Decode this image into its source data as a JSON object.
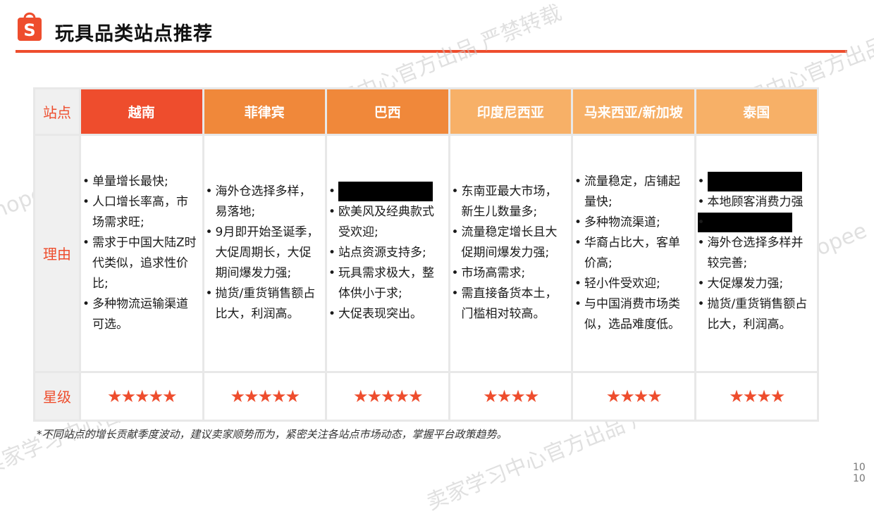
{
  "header": {
    "title": "玩具品类站点推荐",
    "logo_letter": "S",
    "accent_color": "#ee4d2d"
  },
  "watermarks": [
    "卖家学习中心官方出品 严禁转载",
    "Shopee"
  ],
  "table": {
    "row_labels": {
      "site": "站点",
      "reason": "理由",
      "rating": "星级"
    },
    "columns": [
      {
        "site": "越南",
        "header_color": "#ee4d2d",
        "reasons": [
          "单量增长最快;",
          "人口增长率高，市场需求旺;",
          "需求于中国大陆Z时代类似，追求性价比;",
          "多种物流运输渠道可选。"
        ],
        "stars": "★★★★★",
        "rating": 5
      },
      {
        "site": "菲律宾",
        "header_color": "#f0883a",
        "reasons": [
          "海外仓选择多样，易落地;",
          "9月即开始圣诞季，大促周期长，大促期间爆发力强;",
          "抛货/重货销售额占比大，利润高。"
        ],
        "stars": "★★★★★",
        "rating": 5
      },
      {
        "site": "巴西",
        "header_color": "#f0883a",
        "reasons": [
          "[redacted]",
          "欧美风及经典款式受欢迎;",
          "站点资源支持多;",
          "玩具需求极大，整体供小于求;",
          "大促表现突出。"
        ],
        "stars": "★★★★★",
        "rating": 5
      },
      {
        "site": "印度尼西亚",
        "header_color": "#f7b067",
        "reasons": [
          "东南亚最大市场，新生儿数量多;",
          "流量稳定增长且大促期间爆发力强;",
          "市场高需求;",
          "需直接备货本土，门槛相对较高。"
        ],
        "stars": "★★★★",
        "rating": 4
      },
      {
        "site": "马来西亚/新加坡",
        "header_color": "#f7b067",
        "reasons": [
          "流量稳定，店铺起量快;",
          "多种物流渠道;",
          "华裔占比大，客单价高;",
          "轻小件受欢迎;",
          "与中国消费市场类似，选品难度低。"
        ],
        "stars": "★★★★",
        "rating": 4
      },
      {
        "site": "泰国",
        "header_color": "#f7b067",
        "reasons": [
          "[redacted]",
          "本地顾客消费力强",
          "[redacted]",
          "海外仓选择多样并较完善;",
          "大促爆发力强;",
          "抛货/重货销售额占比大，利润高。"
        ],
        "stars": "★★★★",
        "rating": 4
      }
    ]
  },
  "footnote": "*不同站点的增长贡献季度波动，建议卖家顺势而为，紧密关注各站点市场动态，掌握平台政策趋势。",
  "page_number": "10"
}
